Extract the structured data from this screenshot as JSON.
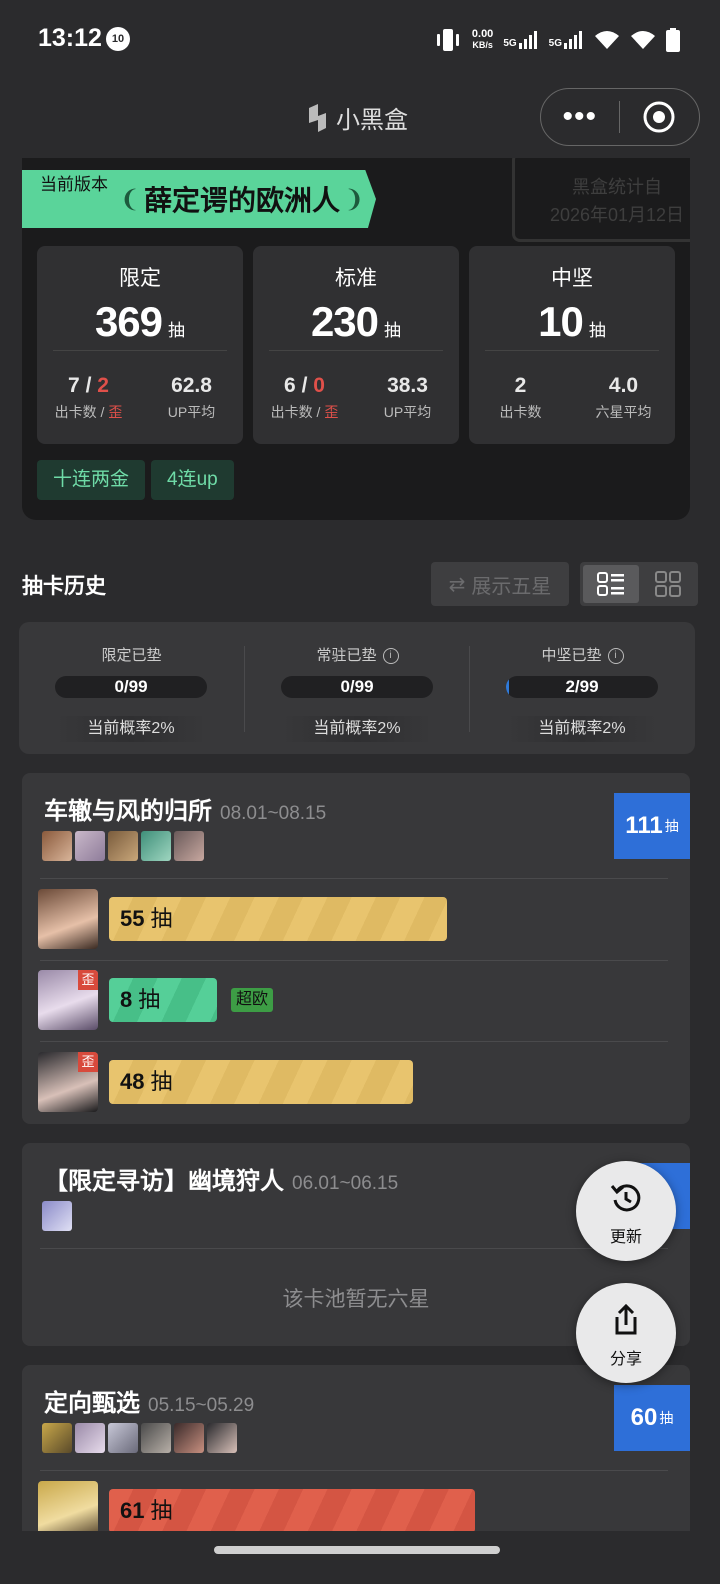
{
  "status_bar": {
    "time": "13:12",
    "notification_badge": "10",
    "net_speed": "0.00",
    "net_unit": "KB/s",
    "sig1": "5G",
    "sig2": "5G"
  },
  "app": {
    "title": "小黑盒"
  },
  "summary": {
    "version_label": "当前版本",
    "banner_title": "薛定谔的欧洲人",
    "stamp_line1": "黑盒统计自",
    "stamp_line2": "2026年01月12日",
    "boxes": [
      {
        "label": "限定",
        "total": "369",
        "unit": "抽",
        "a_count": "7",
        "a_sep": " / ",
        "a_wai": "2",
        "a_label": "出卡数 / ",
        "a_label_wai": "歪",
        "b_value": "62.8",
        "b_label": "UP平均"
      },
      {
        "label": "标准",
        "total": "230",
        "unit": "抽",
        "a_count": "6",
        "a_sep": " / ",
        "a_wai": "0",
        "a_label": "出卡数 / ",
        "a_label_wai": "歪",
        "b_value": "38.3",
        "b_label": "UP平均"
      },
      {
        "label": "中坚",
        "total": "10",
        "unit": "抽",
        "a_count": "2",
        "a_label": "出卡数",
        "b_value": "4.0",
        "b_label": "六星平均"
      }
    ],
    "tags": [
      "十连两金",
      "4连up"
    ]
  },
  "history": {
    "title": "抽卡历史",
    "show_five_star": "展示五星",
    "pity": [
      {
        "label": "限定已垫",
        "value": "0/99",
        "progress": 0,
        "rate": "当前概率2%"
      },
      {
        "label": "常驻已垫",
        "value": "0/99",
        "progress": 0,
        "rate": "当前概率2%"
      },
      {
        "label": "中坚已垫",
        "value": "2/99",
        "progress": 0.0202,
        "rate": "当前概率2%"
      }
    ]
  },
  "pools": [
    {
      "name": "车辙与风的归所",
      "dates": "08.01~08.15",
      "total": "111",
      "unit": "抽",
      "pulls": [
        {
          "count": "55",
          "unit": "抽",
          "color": "gold",
          "wai": ""
        },
        {
          "count": "8",
          "unit": "抽",
          "color": "green",
          "wai": "歪",
          "tag": "超欧"
        },
        {
          "count": "48",
          "unit": "抽",
          "color": "gold",
          "wai": "歪"
        }
      ]
    },
    {
      "name": "【限定寻访】幽境狩人",
      "dates": "06.01~06.15",
      "total": "0",
      "unit": "抽",
      "empty_text": "该卡池暂无六星"
    },
    {
      "name": "定向甄选",
      "dates": "05.15~05.29",
      "total": "60",
      "unit": "抽",
      "pulls": [
        {
          "count": "61",
          "unit": "抽",
          "color": "red",
          "wai": ""
        }
      ]
    }
  ],
  "fab": {
    "refresh": "更新",
    "share": "分享"
  },
  "colors": {
    "accent_green": "#5ad49a",
    "bar_gold": "#e8c46e",
    "bar_green": "#55cf98",
    "bar_red": "#e0604c",
    "total_blue": "#2e6fd8",
    "wai_red": "#d84a3c"
  }
}
